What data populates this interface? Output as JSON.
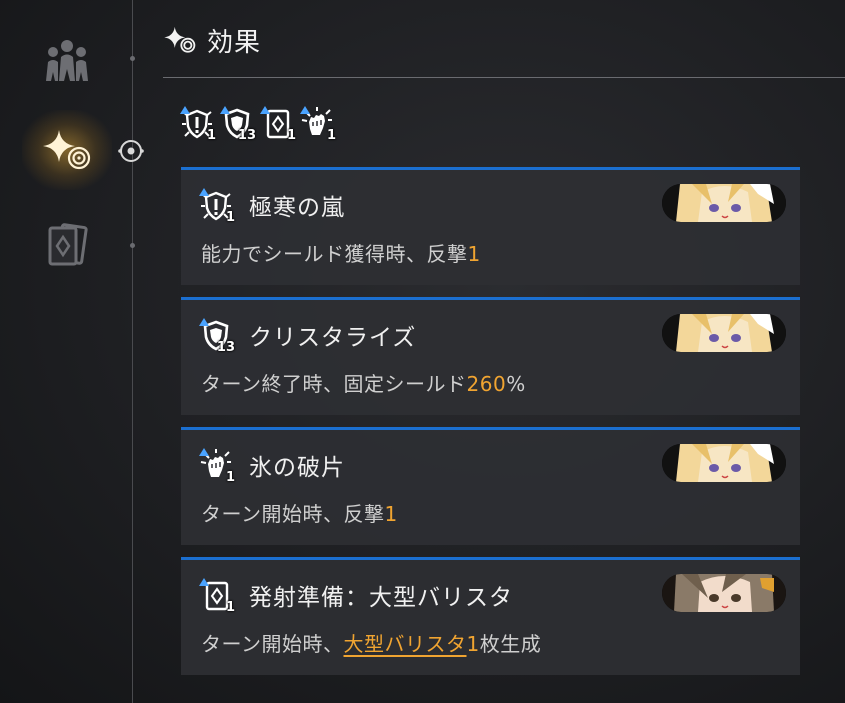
{
  "header": {
    "title": "効果",
    "icon": "sparkle-icon"
  },
  "rail": {
    "items": [
      {
        "name": "party",
        "icon": "party-icon",
        "active": false
      },
      {
        "name": "effects",
        "icon": "sparkle-icon",
        "active": true
      },
      {
        "name": "cards",
        "icon": "card-icon",
        "active": false
      }
    ]
  },
  "summary": [
    {
      "icon": "shatter-shield-icon",
      "count": "1"
    },
    {
      "icon": "shield-icon",
      "count": "13"
    },
    {
      "icon": "card-stack-icon",
      "count": "1"
    },
    {
      "icon": "ice-fist-icon",
      "count": "1"
    }
  ],
  "effects": [
    {
      "title": "極寒の嵐",
      "icon": "shatter-shield-icon",
      "count": "1",
      "desc_pre": "能力でシールド獲得時、反撃",
      "desc_val": "1",
      "desc_post": "",
      "portrait": "blonde-character"
    },
    {
      "title": "クリスタライズ",
      "icon": "shield-icon",
      "count": "13",
      "desc_pre": "ターン終了時、固定シールド",
      "desc_val": "260",
      "desc_post": "%",
      "portrait": "blonde-character"
    },
    {
      "title": "氷の破片",
      "icon": "ice-fist-icon",
      "count": "1",
      "desc_pre": "ターン開始時、反撃",
      "desc_val": "1",
      "desc_post": "",
      "portrait": "blonde-character"
    },
    {
      "title": "発射準備：大型バリスタ",
      "icon": "card-stack-icon",
      "count": "1",
      "desc_pre": "ターン開始時、",
      "desc_link": "大型バリスタ",
      "desc_val": "1",
      "desc_post": "枚生成",
      "portrait": "brunette-character"
    }
  ],
  "colors": {
    "accent": "#1b6fd0",
    "highlight": "#f0a431",
    "arrow": "#4aa3ff"
  }
}
